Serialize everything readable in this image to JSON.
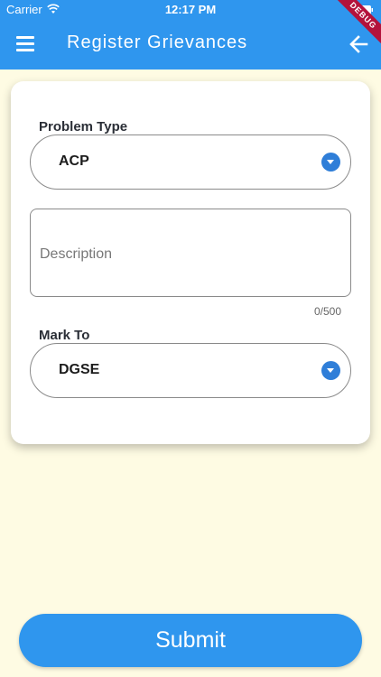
{
  "status_bar": {
    "carrier": "Carrier",
    "time": "12:17 PM"
  },
  "debug_banner": "DEBUG",
  "app_bar": {
    "title": "Register Grievances",
    "menu_icon": "hamburger-menu-icon",
    "back_icon": "arrow-back-icon"
  },
  "form": {
    "problem_type": {
      "label": "Problem Type",
      "value": "ACP"
    },
    "description": {
      "placeholder": "Description",
      "counter": "0/500"
    },
    "mark_to": {
      "label": "Mark To",
      "value": "DGSE"
    }
  },
  "submit_label": "Submit",
  "colors": {
    "primary": "#2f96ee",
    "background": "#fefbe3",
    "dropdown_icon": "#2f7ed8",
    "debug": "#b3123b"
  }
}
